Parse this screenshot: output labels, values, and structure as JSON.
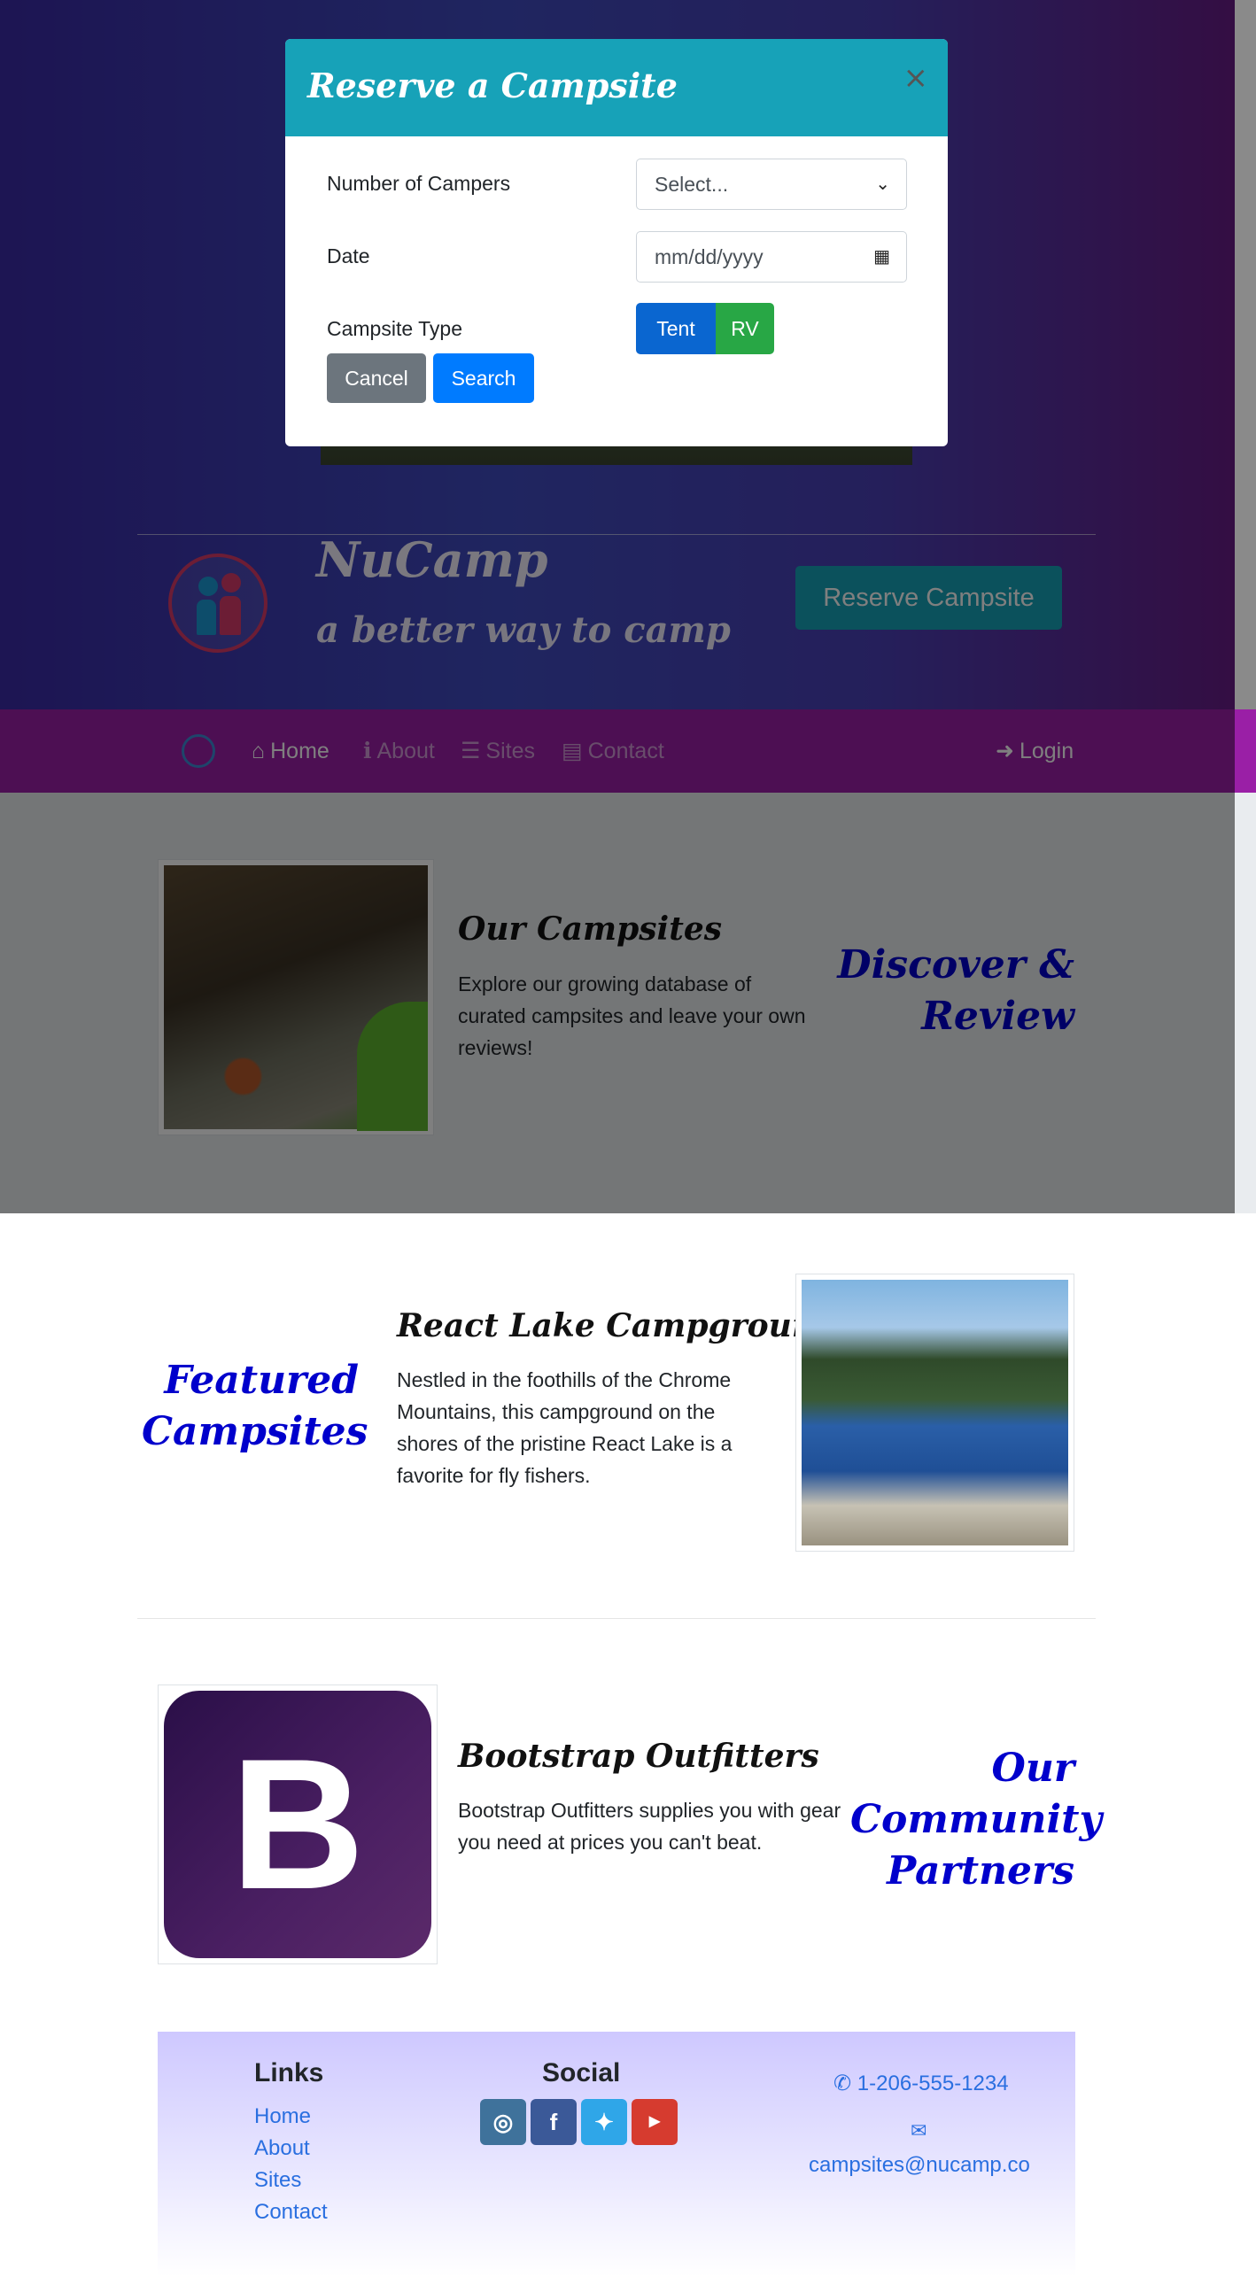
{
  "modal": {
    "title": "Reserve a Campsite",
    "close_glyph": "×",
    "fields": {
      "campers_label": "Number of Campers",
      "campers_value": "Select...",
      "date_label": "Date",
      "date_placeholder": "mm/dd/yyyy",
      "type_label": "Campsite Type"
    },
    "buttons": {
      "tent": "Tent",
      "rv": "RV",
      "cancel": "Cancel",
      "search": "Search"
    }
  },
  "jumbotron": {
    "title": "NuCamp",
    "subtitle": "a better way to camp",
    "reserve_button": "Reserve Campsite"
  },
  "navbar": {
    "items": [
      {
        "label": "Home",
        "icon": "home-icon",
        "active": true
      },
      {
        "label": "About",
        "icon": "info-icon",
        "active": false
      },
      {
        "label": "Sites",
        "icon": "list-icon",
        "active": false
      },
      {
        "label": "Contact",
        "icon": "address-card-icon",
        "active": false
      }
    ],
    "login": "Login"
  },
  "sections": {
    "campsites": {
      "title": "Our Campsites",
      "text": "Explore our growing database of curated campsites and leave your own reviews!",
      "side_heading": [
        "Discover &",
        "Review"
      ]
    },
    "featured": {
      "title": "React Lake Campground",
      "text": "Nestled in the foothills of the Chrome Mountains, this campground on the shores of the pristine React Lake is a favorite for fly fishers.",
      "side_heading": [
        "Featured",
        "Campsites"
      ]
    },
    "partners": {
      "title": "Bootstrap Outfitters",
      "text": "Bootstrap Outfitters supplies you with gear you need at prices you can't beat.",
      "side_heading": [
        "Our",
        "Community",
        "Partners"
      ],
      "logo_letter": "B"
    }
  },
  "footer": {
    "links_heading": "Links",
    "links": [
      "Home",
      "About",
      "Sites",
      "Contact"
    ],
    "social_heading": "Social",
    "social": [
      "instagram",
      "facebook",
      "twitter",
      "youtube"
    ],
    "phone": "1-206-555-1234",
    "email": "campsites@nucamp.co"
  },
  "colors": {
    "accent_teal": "#17a2b8",
    "navbar_purple": "#9a1fa6",
    "heading_blue": "#0000cc",
    "link_blue": "#2a6fe0"
  }
}
